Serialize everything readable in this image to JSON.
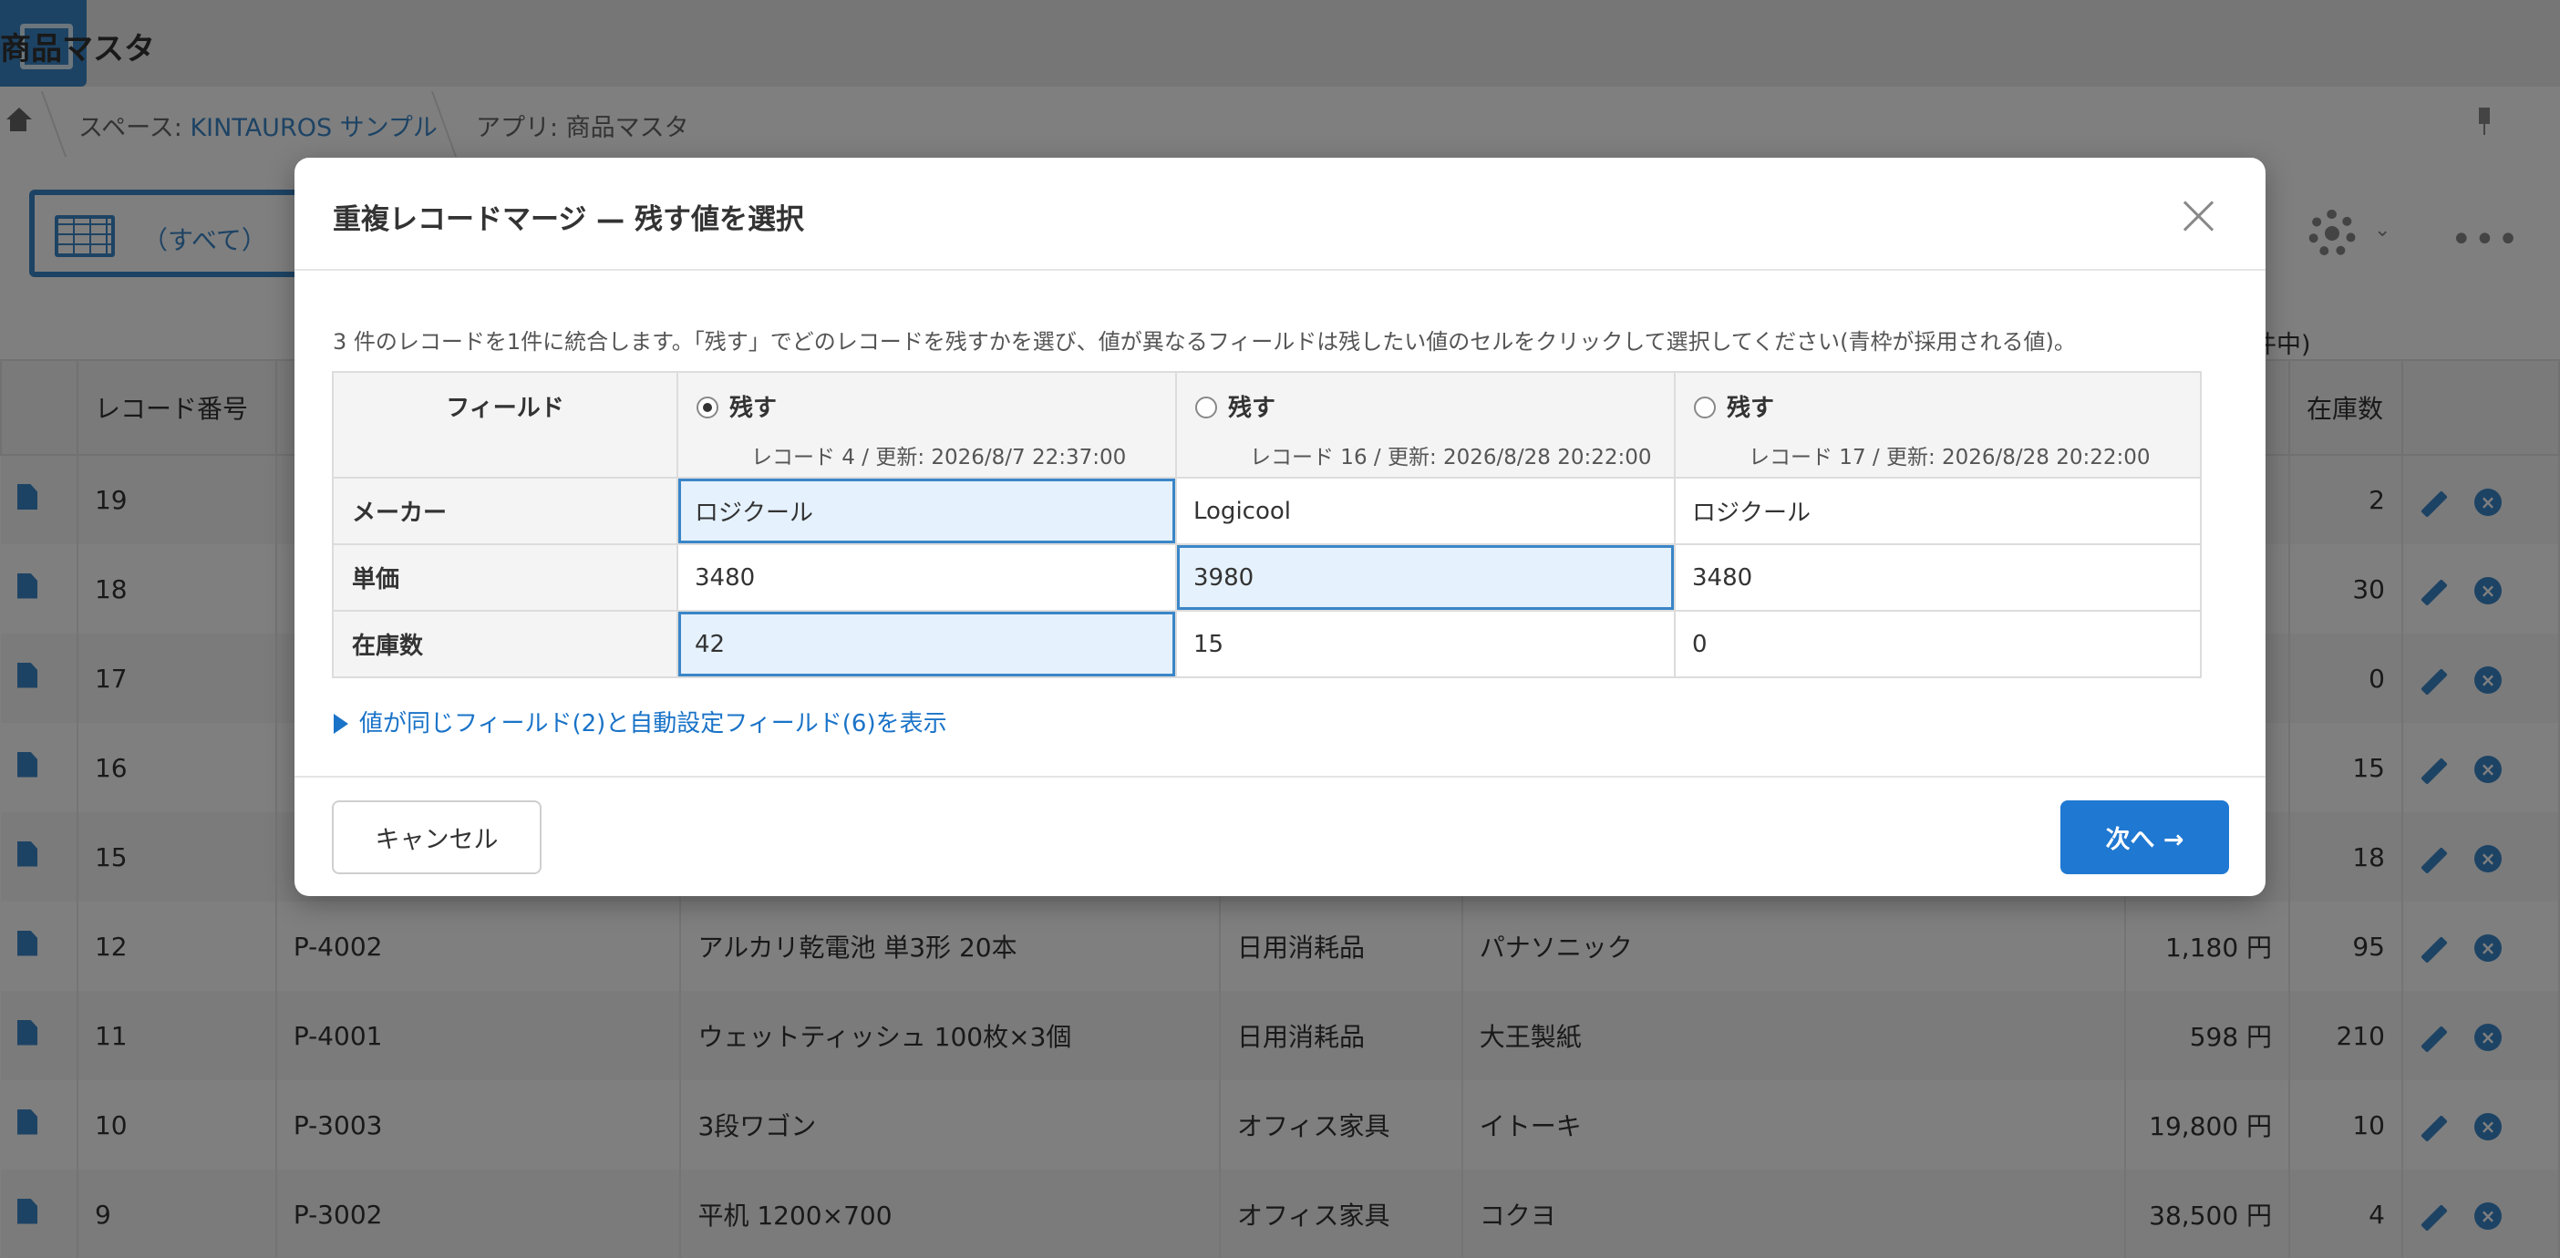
{
  "app": {
    "title": "商品マスタ",
    "breadcrumb": {
      "space_prefix": "スペース: ",
      "space_name": "KINTAUROS サンプル",
      "app_label": "アプリ: 商品マスタ"
    },
    "view_label": "（すべて）",
    "count_label": "件中)",
    "columns": [
      "レコード番号",
      "",
      "",
      "",
      "",
      "",
      "在庫数"
    ],
    "rows": [
      {
        "id": "19",
        "code": "",
        "name": "",
        "category": "",
        "maker": "",
        "price": "",
        "stock": "2"
      },
      {
        "id": "18",
        "code": "",
        "name": "",
        "category": "",
        "maker": "",
        "price": "",
        "stock": "30"
      },
      {
        "id": "17",
        "code": "",
        "name": "",
        "category": "",
        "maker": "",
        "price": "",
        "stock": "0"
      },
      {
        "id": "16",
        "code": "",
        "name": "",
        "category": "",
        "maker": "",
        "price": "",
        "stock": "15"
      },
      {
        "id": "15",
        "code": "",
        "name": "",
        "category": "",
        "maker": "",
        "price": "",
        "stock": "18"
      },
      {
        "id": "12",
        "code": "P-4002",
        "name": "アルカリ乾電池 単3形 20本",
        "category": "日用消耗品",
        "maker": "パナソニック",
        "price": "1,180 円",
        "stock": "95"
      },
      {
        "id": "11",
        "code": "P-4001",
        "name": "ウェットティッシュ 100枚×3個",
        "category": "日用消耗品",
        "maker": "大王製紙",
        "price": "598 円",
        "stock": "210"
      },
      {
        "id": "10",
        "code": "P-3003",
        "name": "3段ワゴン",
        "category": "オフィス家具",
        "maker": "イトーキ",
        "price": "19,800 円",
        "stock": "10"
      },
      {
        "id": "9",
        "code": "P-3002",
        "name": "平机 1200×700",
        "category": "オフィス家具",
        "maker": "コクヨ",
        "price": "38,500 円",
        "stock": "4"
      }
    ]
  },
  "modal": {
    "title": "重複レコードマージ — 残す値を選択",
    "description": "3 件のレコードを1件に統合します。「残す」でどのレコードを残すかを選び、値が異なるフィールドは残したい値のセルをクリックして選択してください(青枠が採用される値)。",
    "field_header": "フィールド",
    "records": [
      {
        "keep_label": "残す",
        "meta": "レコード 4 / 更新: 2026/8/7 22:37:00",
        "keep_selected": true
      },
      {
        "keep_label": "残す",
        "meta": "レコード 16 / 更新: 2026/8/28 20:22:00",
        "keep_selected": false
      },
      {
        "keep_label": "残す",
        "meta": "レコード 17 / 更新: 2026/8/28 20:22:00",
        "keep_selected": false
      }
    ],
    "fields": [
      {
        "name": "メーカー",
        "values": [
          "ロジクール",
          "Logicool",
          "ロジクール"
        ],
        "selected": 0
      },
      {
        "name": "単価",
        "values": [
          "3480",
          "3980",
          "3480"
        ],
        "selected": 1
      },
      {
        "name": "在庫数",
        "values": [
          "42",
          "15",
          "0"
        ],
        "selected": 0
      }
    ],
    "toggle_label": "値が同じフィールド(2)と自動設定フィールド(6)を表示",
    "cancel_label": "キャンセル",
    "next_label": "次へ →"
  },
  "colors": {
    "accent": "#1f78d1",
    "selected_bg": "#e5f1fc",
    "overlay": "rgba(0,0,0,0.5)"
  }
}
